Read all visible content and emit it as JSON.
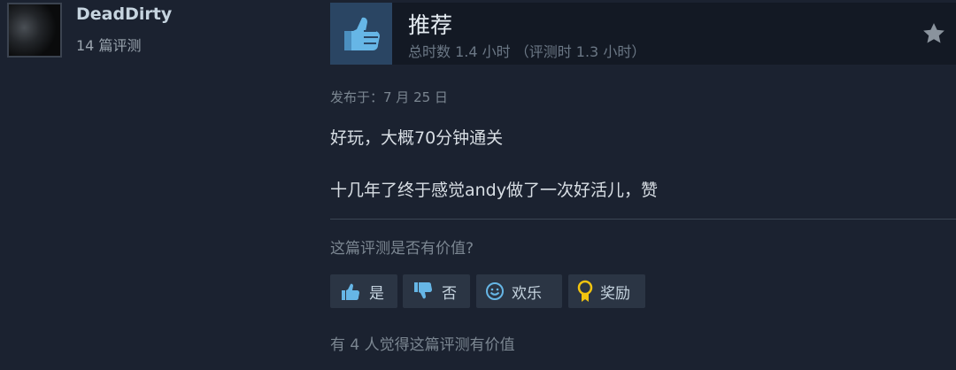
{
  "user": {
    "name": "DeadDirty",
    "review_count": "14 篇评测"
  },
  "recommendation": {
    "title": "推荐",
    "hours": "总时数 1.4 小时 （评测时 1.3 小时）"
  },
  "review": {
    "posted": "发布于：7 月 25 日",
    "paragraphs": [
      "好玩，大概70分钟通关",
      "十几年了终于感觉andy做了一次好活儿，赞"
    ]
  },
  "feedback": {
    "question": "这篇评测是否有价值?",
    "buttons": {
      "yes": "是",
      "no": "否",
      "funny": "欢乐",
      "award": "奖励"
    },
    "helpful_count": "有 4 人觉得这篇评测有价值"
  },
  "colors": {
    "background": "#1b2230",
    "header_bar": "#131924",
    "thumb_box": "#2a4563",
    "thumb_icon": "#66b6e6",
    "button_bg": "#2b3544",
    "award_icon": "#f1c40f"
  },
  "icons": [
    "thumbs-up-icon",
    "star-icon",
    "thumbs-down-icon",
    "smiley-icon",
    "award-ribbon-icon"
  ]
}
